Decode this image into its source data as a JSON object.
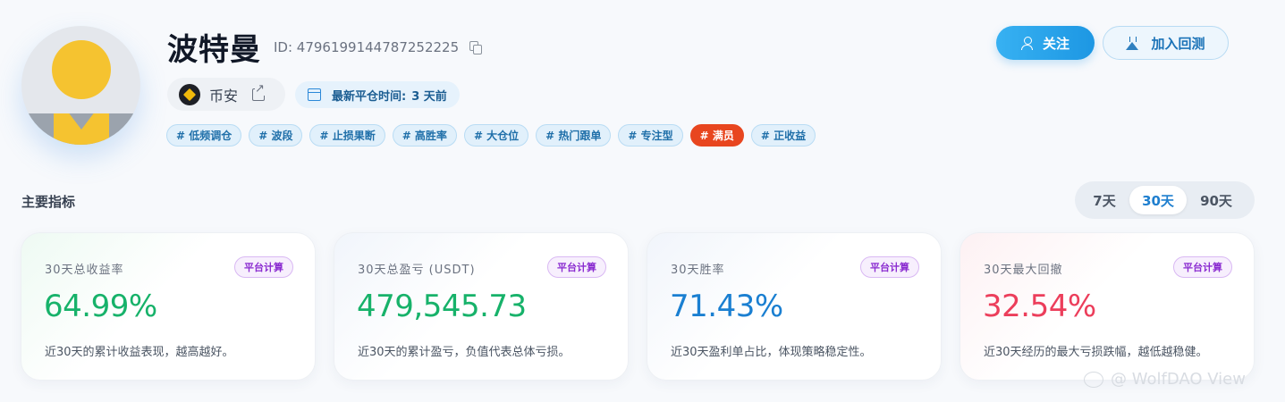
{
  "profile": {
    "name": "波特曼",
    "id_text": "ID: 4796199144787252225",
    "exchange": "币安",
    "last_trade_label": "最新平仓时间:",
    "last_trade_value": "3 天前"
  },
  "tags": [
    "# 低频调仓",
    "# 波段",
    "# 止损果断",
    "# 高胜率",
    "# 大仓位",
    "# 热门跟单",
    "# 专注型",
    "# 满员",
    "# 正收益"
  ],
  "actions": {
    "follow_label": "关注",
    "backtest_label": "加入回测"
  },
  "section": {
    "title": "主要指标",
    "periods": [
      "7天",
      "30天",
      "90天"
    ],
    "selected_period": "30天"
  },
  "metrics": [
    {
      "title": "30天总收益率",
      "badge": "平台计算",
      "value": "64.99%",
      "desc": "近30天的累计收益表现，越高越好。",
      "color": "#17b26a"
    },
    {
      "title": "30天总盈亏 (USDT)",
      "badge": "平台计算",
      "value": "479,545.73",
      "desc": "近30天的累计盈亏，负值代表总体亏损。",
      "color": "#17b26a"
    },
    {
      "title": "30天胜率",
      "badge": "平台计算",
      "value": "71.43%",
      "desc": "近30天盈利单占比，体现策略稳定性。",
      "color": "#1a7fd1"
    },
    {
      "title": "30天最大回撤",
      "badge": "平台计算",
      "value": "32.54%",
      "desc": "近30天经历的最大亏损跌幅，越低越稳健。",
      "color": "#ec3e5b"
    }
  ],
  "watermark": "@ WolfDAO View",
  "colors": {
    "accent": "#1d97e3",
    "hot_tag": "#e8461f",
    "badge_purple": "#8a2bd0"
  }
}
